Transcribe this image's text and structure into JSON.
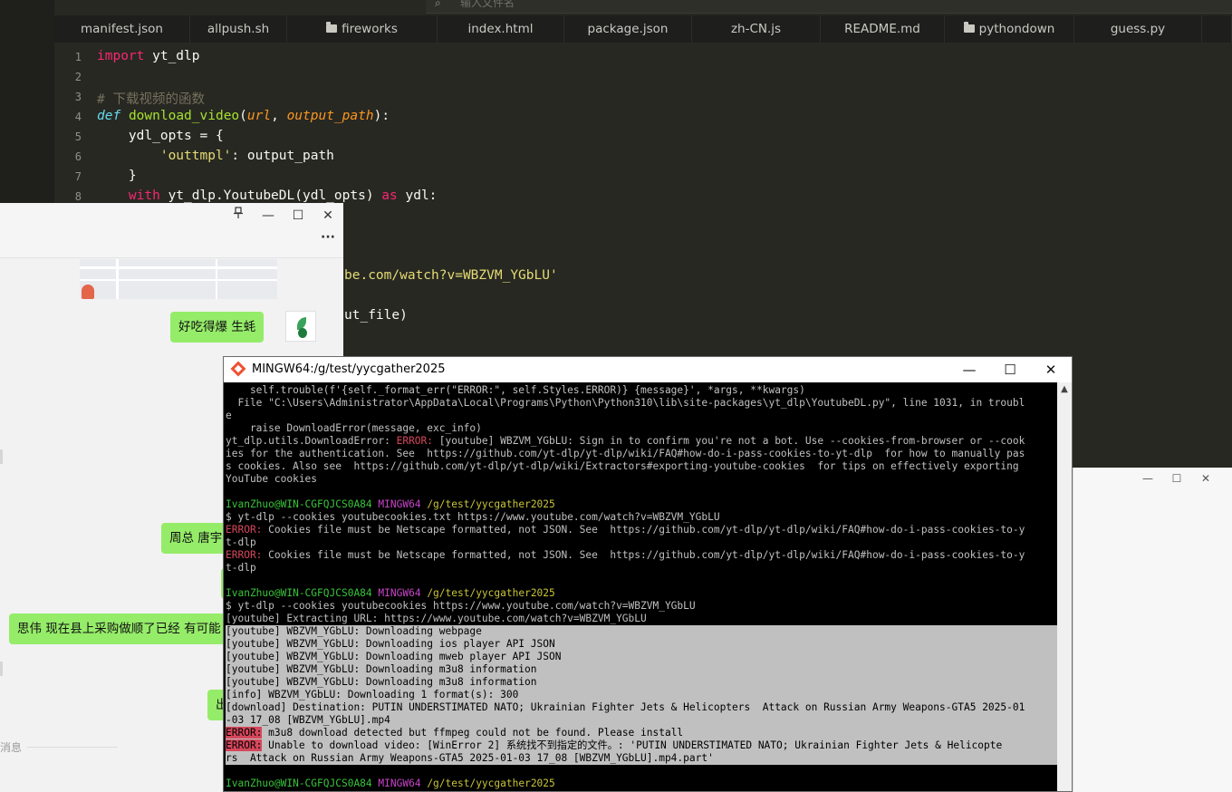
{
  "editor": {
    "search_placeholder": "输入文件名",
    "tabs": [
      {
        "label": "manifest.json",
        "folder": false
      },
      {
        "label": "allpush.sh",
        "folder": false
      },
      {
        "label": "fireworks",
        "folder": true
      },
      {
        "label": "index.html",
        "folder": false
      },
      {
        "label": "package.json",
        "folder": false
      },
      {
        "label": "zh-CN.js",
        "folder": false
      },
      {
        "label": "README.md",
        "folder": false
      },
      {
        "label": "pythondown",
        "folder": true
      },
      {
        "label": "guess.py",
        "folder": false
      }
    ],
    "line_numbers": [
      "1",
      "2",
      "3",
      "4",
      "5",
      "6",
      "7",
      "8"
    ],
    "code_fragments": {
      "l1_import": "import",
      "l1_mod": " yt_dlp",
      "l3_comment": "# 下载视频的函数",
      "l4_def": "def",
      "l4_fn": "download_video",
      "l4_open": "(",
      "l4_p1": "url",
      "l4_comma": ", ",
      "l4_p2": "output_path",
      "l4_close": "):",
      "l5": "    ydl_opts = {",
      "l6_str": "'outtmpl'",
      "l6_rest": ": output_path",
      "l7": "    }",
      "l8_with": "with",
      "l8_mid": " yt_dlp.YoutubeDL(ydl_opts) ",
      "l8_as": "as",
      "l8_end": " ydl:",
      "partial_url": "be.com/watch?v=WBZVM_YGbLU'",
      "partial_call": "ut_file)"
    }
  },
  "chat": {
    "pin_icon": "pin-icon",
    "minimize_glyph": "—",
    "maximize_glyph": "☐",
    "close_glyph": "✕",
    "more_glyph": "···",
    "bubbles": [
      "好吃得爆   生蚝",
      "周总 唐宇",
      "思伟 现在县上采购做顺了已经 有可能",
      "出"
    ],
    "messages_label": "消息"
  },
  "small_window": {
    "minimize_glyph": "—",
    "maximize_glyph": "☐",
    "close_glyph": "✕"
  },
  "terminal": {
    "title": "MINGW64:/g/test/yycgather2025",
    "minimize_glyph": "—",
    "maximize_glyph": "☐",
    "close_glyph": "✕",
    "scroll_up_glyph": "▲",
    "prompt_user": "IvanZhuo@WIN-CGFQJCS0A84",
    "prompt_env": "MINGW64",
    "prompt_path": "/g/test/yycgather2025",
    "error_tag": "ERROR:",
    "lines": {
      "l0": "    self.trouble(f'{self._format_err(\"ERROR:\", self.Styles.ERROR)} {message}', *args, **kwargs)",
      "l1": "  File \"C:\\Users\\Administrator\\AppData\\Local\\Programs\\Python\\Python310\\lib\\site-packages\\yt_dlp\\YoutubeDL.py\", line 1031, in troubl",
      "l2": "e",
      "l3": "    raise DownloadError(message, exc_info)",
      "l4_pre": "yt_dlp.utils.DownloadError: ",
      "l4_post": " [youtube] WBZVM_YGbLU: Sign in to confirm you're not a bot. Use --cookies-from-browser or --cook",
      "l5": "ies for the authentication. See  https://github.com/yt-dlp/yt-dlp/wiki/FAQ#how-do-i-pass-cookies-to-yt-dlp  for how to manually pas",
      "l6": "s cookies. Also see  https://github.com/yt-dlp/yt-dlp/wiki/Extractors#exporting-youtube-cookies  for tips on effectively exporting",
      "l7": "YouTube cookies",
      "l10": "$ yt-dlp --cookies youtubecookies.txt https://www.youtube.com/watch?v=WBZVM_YGbLU",
      "l11_post": " Cookies file must be Netscape formatted, not JSON. See  https://github.com/yt-dlp/yt-dlp/wiki/FAQ#how-do-i-pass-cookies-to-y",
      "l12": "t-dlp",
      "l13_post": " Cookies file must be Netscape formatted, not JSON. See  https://github.com/yt-dlp/yt-dlp/wiki/FAQ#how-do-i-pass-cookies-to-y",
      "l14": "t-dlp",
      "l17": "$ yt-dlp --cookies youtubecookies https://www.youtube.com/watch?v=WBZVM_YGbLU",
      "l18": "[youtube] Extracting URL: https://www.youtube.com/watch?v=WBZVM_YGbLU",
      "l19": "[youtube] WBZVM_YGbLU: Downloading webpage",
      "l20": "[youtube] WBZVM_YGbLU: Downloading ios player API JSON",
      "l21": "[youtube] WBZVM_YGbLU: Downloading mweb player API JSON",
      "l22": "[youtube] WBZVM_YGbLU: Downloading m3u8 information",
      "l23": "[youtube] WBZVM_YGbLU: Downloading m3u8 information",
      "l24": "[info] WBZVM_YGbLU: Downloading 1 format(s): 300",
      "l25": "[download] Destination: PUTIN UNDERSTIMATED NATO; Ukrainian Fighter Jets & Helicopters  Attack on Russian Army Weapons-GTA5 2025-01",
      "l26": "-03 17_08 [WBZVM_YGbLU].mp4",
      "l27_post": " m3u8 download detected but ffmpeg could not be found. Please install",
      "l28_post": " Unable to download video: [WinError 2] 系统找不到指定的文件。: 'PUTIN UNDERSTIMATED NATO; Ukrainian Fighter Jets & Helicopte",
      "l29": "rs  Attack on Russian Army Weapons-GTA5 2025-01-03 17_08 [WBZVM_YGbLU].mp4.part'"
    }
  }
}
